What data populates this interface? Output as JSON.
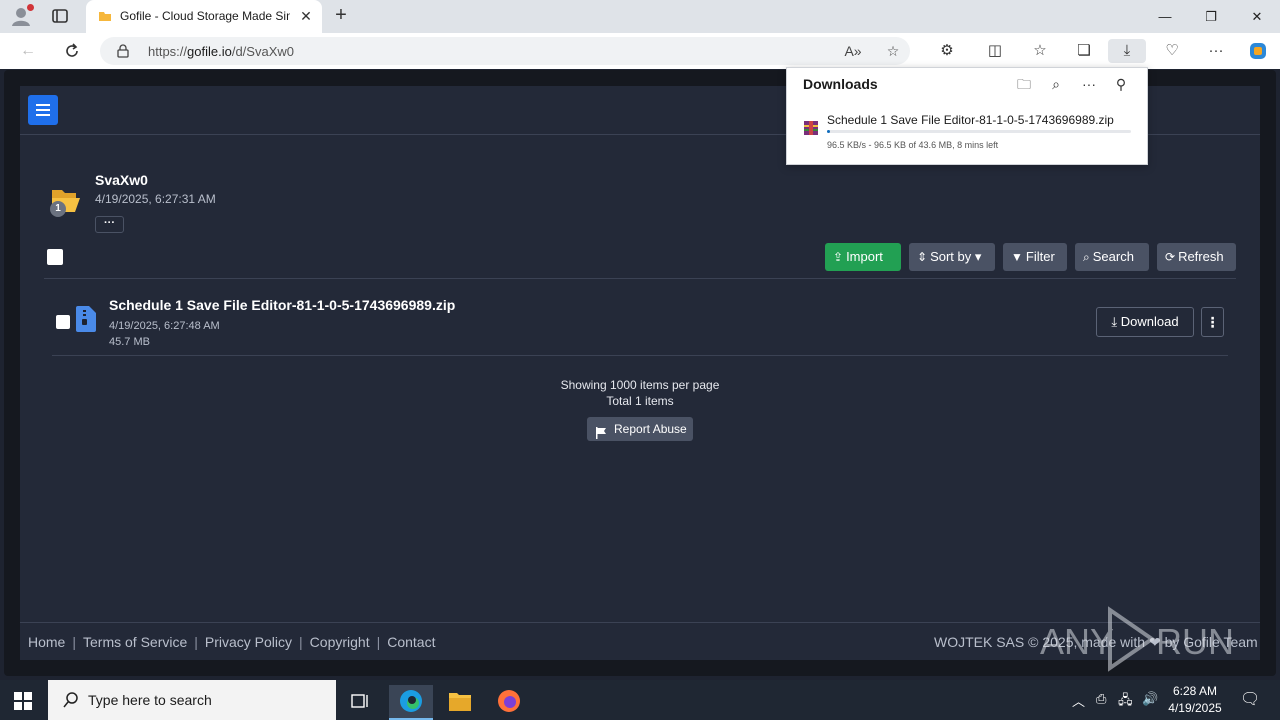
{
  "browser": {
    "tab_title": "Gofile - Cloud Storage Made Simple",
    "new_tab": "+",
    "url_prefix": "https://",
    "url_host": "gofile.io",
    "url_path": "/d/SvaXw0",
    "window_controls": {
      "minimize": "—",
      "maximize": "❐",
      "close": "✕"
    }
  },
  "downloads_panel": {
    "title": "Downloads",
    "file_name": "Schedule 1 Save File Editor-81-1-0-5-1743696989.zip",
    "status": "96.5 KB/s - 96.5 KB of 43.6 MB, 8 mins left",
    "progress_fraction": 0.002
  },
  "folder": {
    "name": "SvaXw0",
    "date": "4/19/2025, 6:27:31 AM",
    "count": "1",
    "more": "···"
  },
  "toolbar": {
    "import": "Import",
    "sort_by": "Sort by",
    "filter": "Filter",
    "search": "Search",
    "refresh": "Refresh"
  },
  "files": [
    {
      "name": "Schedule 1 Save File Editor-81-1-0-5-1743696989.zip",
      "date": "4/19/2025, 6:27:48 AM",
      "size": "45.7 MB",
      "download": "Download"
    }
  ],
  "pagination": {
    "per_page": "Showing 1000 items per page",
    "total": "Total 1 items"
  },
  "report_abuse": "Report Abuse",
  "footer": {
    "links": [
      "Home",
      "Terms of Service",
      "Privacy Policy",
      "Copyright",
      "Contact"
    ],
    "credit": "WOJTEK SAS © 2025, made with ❤ by Gofile Team"
  },
  "watermark": "ANY.RUN",
  "taskbar": {
    "search_placeholder": "Type here to search",
    "time": "6:28 AM",
    "date": "4/19/2025"
  },
  "colors": {
    "accent": "#1f6feb",
    "import_green": "#22a053",
    "page_bg": "#232938"
  }
}
